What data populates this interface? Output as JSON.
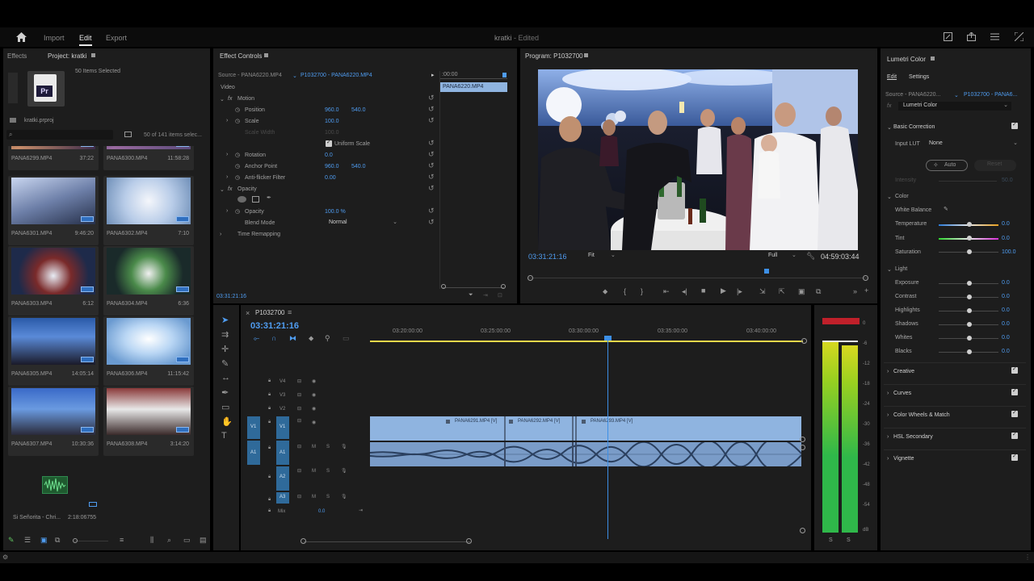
{
  "app": {
    "project_title": "kratki",
    "edited_status": "- Edited"
  },
  "nav": {
    "home_icon": "home-icon",
    "tabs": [
      "Import",
      "Edit",
      "Export"
    ],
    "active_tab": "Edit"
  },
  "project_panel": {
    "tabs": [
      "Effects",
      "Project: kratki"
    ],
    "file_name": "kratki.prproj",
    "selected_info": "50 Items Selected",
    "count_info": "50 of 141 items selec...",
    "top_row": [
      {
        "name": "PANA6299.MP4",
        "duration": "37:22"
      },
      {
        "name": "PANA6300.MP4",
        "duration": "11:58:28"
      }
    ],
    "clips": [
      {
        "name": "PANA6301.MP4",
        "duration": "9:46:20"
      },
      {
        "name": "PANA6302.MP4",
        "duration": "7:10"
      },
      {
        "name": "PANA6303.MP4",
        "duration": "6:12"
      },
      {
        "name": "PANA6304.MP4",
        "duration": "6:36"
      },
      {
        "name": "PANA6305.MP4",
        "duration": "14:05:14"
      },
      {
        "name": "PANA6306.MP4",
        "duration": "11:15:42"
      },
      {
        "name": "PANA6307.MP4",
        "duration": "10:30:36"
      },
      {
        "name": "PANA6308.MP4",
        "duration": "3:14:20"
      }
    ],
    "audio_item": {
      "name": "Si Señorita - Chri...",
      "duration": "2:18:06755"
    }
  },
  "effect_controls": {
    "title": "Effect Controls",
    "source_label": "Source - PANA6220.MP4",
    "clip_label": "P1032700 - PANA6220.MP4",
    "mini_timecode": ":00:00",
    "mini_clip": "PANA6220.MP4",
    "section_video": "Video",
    "motion": "Motion",
    "position_label": "Position",
    "position_x": "960.0",
    "position_y": "540.0",
    "scale_label": "Scale",
    "scale_val": "100.0",
    "scale_width_label": "Scale Width",
    "scale_width_val": "100.0",
    "uniform_scale": "Uniform Scale",
    "rotation_label": "Rotation",
    "rotation_val": "0.0",
    "anchor_label": "Anchor Point",
    "anchor_x": "960.0",
    "anchor_y": "540.0",
    "antiflicker_label": "Anti-flicker Filter",
    "antiflicker_val": "0.00",
    "opacity_section": "Opacity",
    "opacity_label": "Opacity",
    "opacity_val": "100.0 %",
    "blend_label": "Blend Mode",
    "blend_val": "Normal",
    "time_remap": "Time Remapping",
    "bottom_timecode": "03:31:21:16"
  },
  "program": {
    "title": "Program: P1032700",
    "timecode": "03:31:21:16",
    "fit": "Fit",
    "quality": "Full",
    "duration": "04:59:03:44"
  },
  "timeline": {
    "sequence": "P1032700",
    "timecode": "03:31:21:16",
    "ruler": [
      "03:20:00:00",
      "03:25:00:00",
      "03:30:00:00",
      "03:35:00:00",
      "03:40:00:00"
    ],
    "video_tracks": [
      "V4",
      "V3",
      "V2",
      "V1"
    ],
    "audio_tracks": [
      "A1",
      "A2",
      "A3"
    ],
    "mix_label": "Mix",
    "mix_val": "0.0",
    "clips": [
      "PANA6291.MP4 [V]",
      "PANA6292.MP4 [V]",
      "PANA6293.MP4 [V]"
    ],
    "meter_scale": [
      "0",
      "-6",
      "-12",
      "-18",
      "-24",
      "-30",
      "-36",
      "-42",
      "-48",
      "-54",
      "dB"
    ],
    "meter_solo": [
      "S",
      "S"
    ]
  },
  "lumetri": {
    "title": "Lumetri Color",
    "tabs": [
      "Edit",
      "Settings"
    ],
    "source": "Source - PANA6220...",
    "clip": "P1032700 - PANA6...",
    "fx": "Lumetri Color",
    "basic": "Basic Correction",
    "input_lut_label": "Input LUT",
    "input_lut_val": "None",
    "auto": "Auto",
    "reset": "Reset",
    "intensity_label": "Intensity",
    "intensity_val": "50.0",
    "color_section": "Color",
    "white_balance": "White Balance",
    "temperature": {
      "label": "Temperature",
      "val": "0.0"
    },
    "tint": {
      "label": "Tint",
      "val": "0.0"
    },
    "saturation": {
      "label": "Saturation",
      "val": "100.0"
    },
    "light_section": "Light",
    "light": [
      {
        "label": "Exposure",
        "val": "0.0"
      },
      {
        "label": "Contrast",
        "val": "0.0"
      },
      {
        "label": "Highlights",
        "val": "0.0"
      },
      {
        "label": "Shadows",
        "val": "0.0"
      },
      {
        "label": "Whites",
        "val": "0.0"
      },
      {
        "label": "Blacks",
        "val": "0.0"
      }
    ],
    "sections": [
      "Creative",
      "Curves",
      "Color Wheels & Match",
      "HSL Secondary",
      "Vignette"
    ]
  },
  "colors": {
    "accent": "#4f9cf0",
    "panel": "#1d1d1d",
    "clip": "#8fb4e0",
    "playhead": "#3d8fe6"
  }
}
